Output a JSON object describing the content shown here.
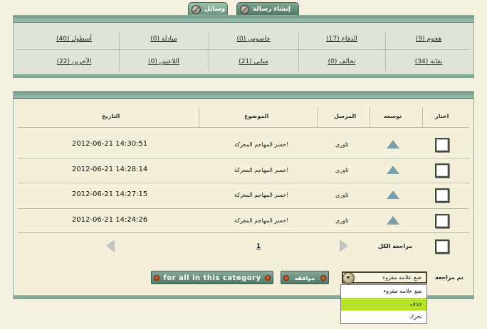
{
  "tabs": [
    {
      "label": "وسائل"
    },
    {
      "label": "إنشاء رسالة"
    }
  ],
  "categories": [
    {
      "label": "هجوم (9)"
    },
    {
      "label": "الدفاع (17)"
    },
    {
      "label": "جاسوس (0)"
    },
    {
      "label": "مبادلة (0)"
    },
    {
      "label": "أسطول (40)"
    },
    {
      "label": "نقابة (34)"
    },
    {
      "label": "تحالف (0)"
    },
    {
      "label": "مباني (21)"
    },
    {
      "label": "اللاعبين (0)"
    },
    {
      "label": "الآخرين (22)"
    }
  ],
  "table": {
    "headers": {
      "select": "اختار",
      "expand": "توسعه",
      "sender": "المرسل",
      "subject": "الموضوع",
      "date": "التاريخ"
    },
    "rows": [
      {
        "sender": "ثاوري",
        "subject": "خسر المهاجم المعركة!",
        "date": "2012-06-21 14:30:51"
      },
      {
        "sender": "ثاوري",
        "subject": "خسر المهاجم المعركة!",
        "date": "2012-06-21 14:28:14"
      },
      {
        "sender": "ثاوري",
        "subject": "خسر المهاجم المعركة!",
        "date": "2012-06-21 14:27:15"
      },
      {
        "sender": "ثاوري",
        "subject": "خسر المهاجم المعركة!",
        "date": "2012-06-21 14:24:26"
      }
    ],
    "select_all_label": "مراجعة الكل",
    "page_number": "1"
  },
  "actions": {
    "reviewed_label": "تم مراجعه",
    "select_value": "ضع علامه مقروء",
    "options": [
      "ضع علامه مقروء",
      "حذف",
      "تحرك"
    ],
    "selected_option_index": 1,
    "ok_button": "موافقه",
    "category_button": "for all in this category"
  }
}
